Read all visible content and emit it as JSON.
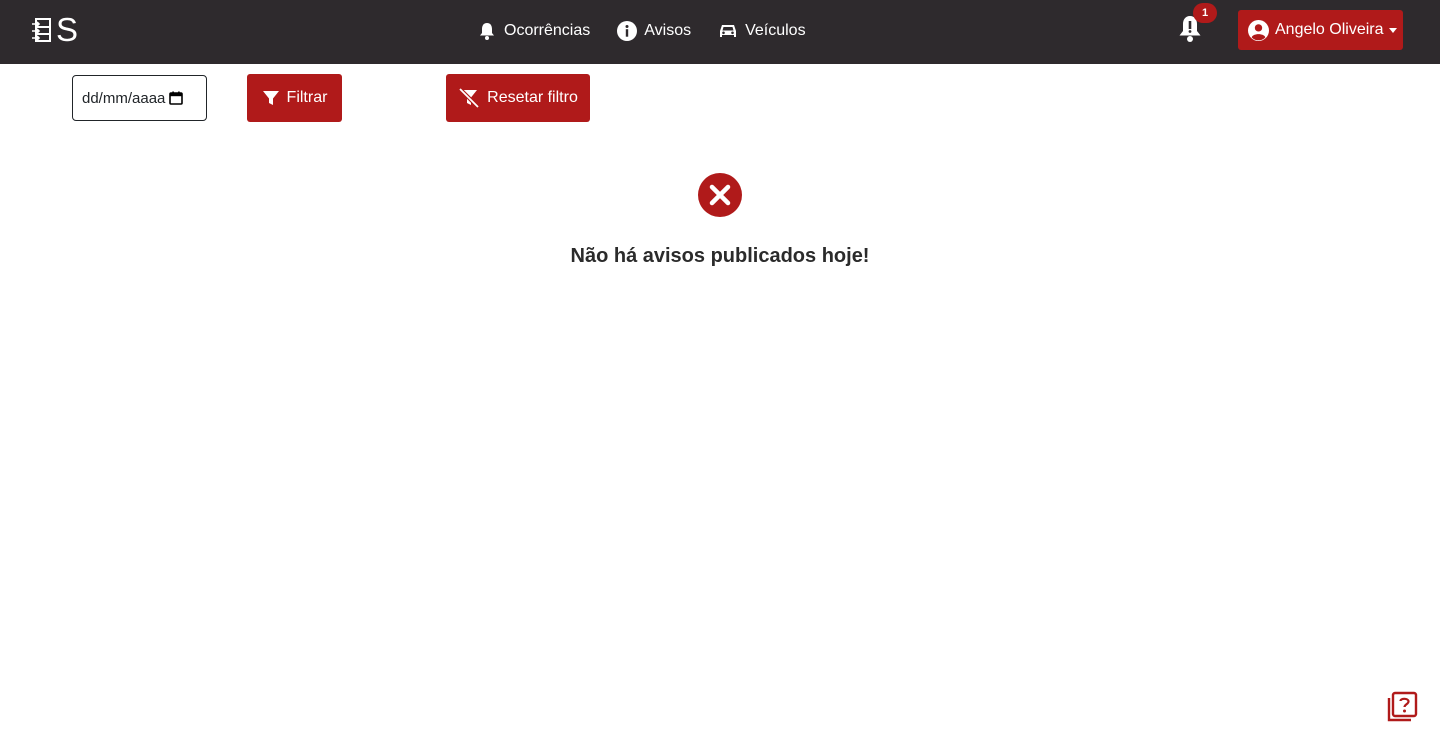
{
  "navbar": {
    "brand_letter": "S",
    "links": [
      {
        "label": "Ocorrências",
        "icon": "bell-icon"
      },
      {
        "label": "Avisos",
        "icon": "info-circle-icon"
      },
      {
        "label": "Veículos",
        "icon": "car-icon"
      }
    ],
    "notification_count": "1",
    "user_name": "Angelo Oliveira"
  },
  "filters": {
    "date_placeholder": "dd/mm/aaaa",
    "filter_label": "Filtrar",
    "reset_label": "Resetar filtro"
  },
  "empty_state": {
    "message": "Não há avisos publicados hoje!",
    "icon": "x-circle-icon"
  },
  "help": {
    "icon": "help-question-icon"
  },
  "colors": {
    "navbar_bg": "#2e2a2d",
    "accent_red": "#b01a1a",
    "text": "#212529"
  }
}
